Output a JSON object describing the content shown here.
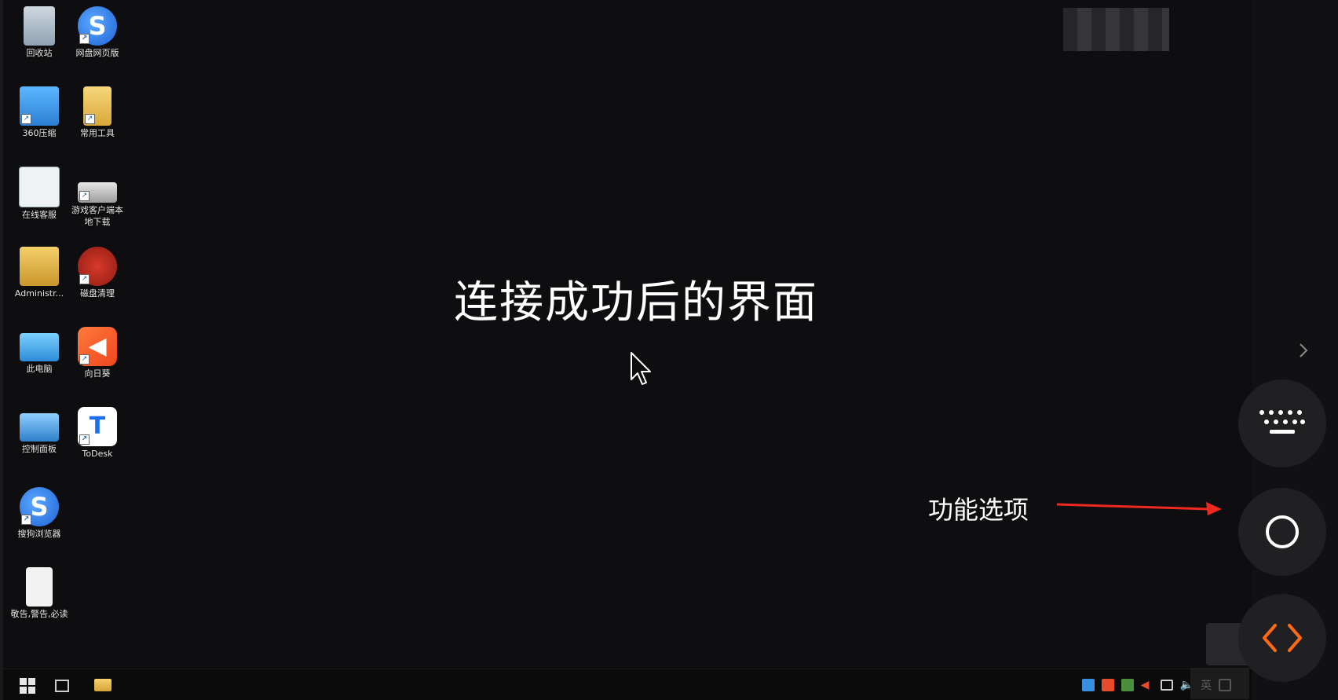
{
  "desktop": {
    "icons": [
      {
        "label": "回收站",
        "icon": "recycle-bin-icon"
      },
      {
        "label": "网盘网页版",
        "icon": "sogou-s-icon"
      },
      {
        "label": "360压缩",
        "icon": "zip-archive-icon"
      },
      {
        "label": "常用工具",
        "icon": "folder-icon"
      },
      {
        "label": "在线客服",
        "icon": "customer-service-icon"
      },
      {
        "label": "游戏客户端本地下载",
        "icon": "drive-icon"
      },
      {
        "label": "Administr...",
        "icon": "user-folder-icon"
      },
      {
        "label": "磁盘清理",
        "icon": "ccleaner-icon"
      },
      {
        "label": "此电脑",
        "icon": "this-pc-icon"
      },
      {
        "label": "向日葵",
        "icon": "sunflower-icon"
      },
      {
        "label": "控制面板",
        "icon": "control-panel-icon"
      },
      {
        "label": "ToDesk",
        "icon": "todesk-icon"
      },
      {
        "label": "搜狗浏览器",
        "icon": "sogou-browser-icon"
      },
      {
        "label": "敬告,警告,必读",
        "icon": "text-document-icon"
      }
    ],
    "center_title": "连接成功后的界面",
    "annotation": "功能选项"
  },
  "side_panel": {
    "buttons": [
      "keyboard-icon",
      "circle-icon",
      "code-brackets-icon"
    ],
    "accent_color": "#ff6a13"
  },
  "taskbar": {
    "tray_language": "英"
  }
}
